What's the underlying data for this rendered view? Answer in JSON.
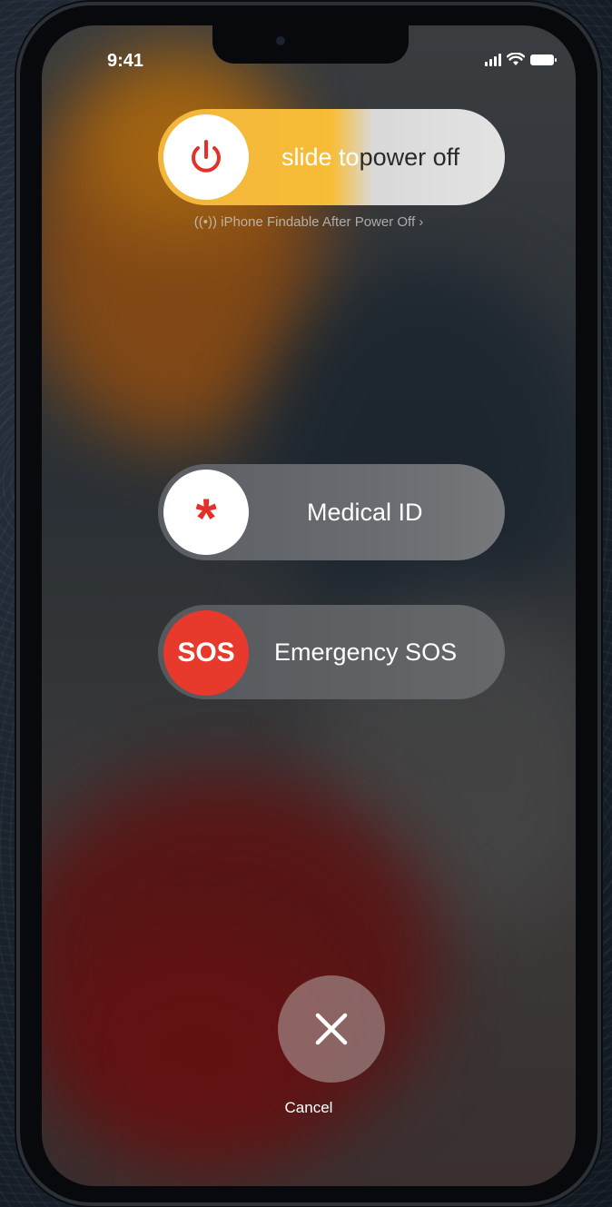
{
  "status_bar": {
    "time": "9:41",
    "signal_icon": "cellular-signal-icon",
    "wifi_icon": "wifi-icon",
    "battery_icon": "battery-icon"
  },
  "power_slider": {
    "icon": "power-icon",
    "label_prefix": "slide to ",
    "label_suffix": "power off",
    "color_start": "#f7bd36",
    "color_end": "#e3e3e3"
  },
  "findable_link": {
    "icon": "findable-signal-icon",
    "text": "iPhone Findable After Power Off",
    "chevron": "chevron-right-icon"
  },
  "medical_slider": {
    "icon": "asterisk-icon",
    "icon_glyph": "*",
    "label": "Medical ID",
    "icon_color": "#e5302a"
  },
  "sos_slider": {
    "icon_text": "SOS",
    "label": "Emergency SOS",
    "knob_color": "#e8392d"
  },
  "cancel": {
    "icon": "close-icon",
    "label": "Cancel"
  }
}
